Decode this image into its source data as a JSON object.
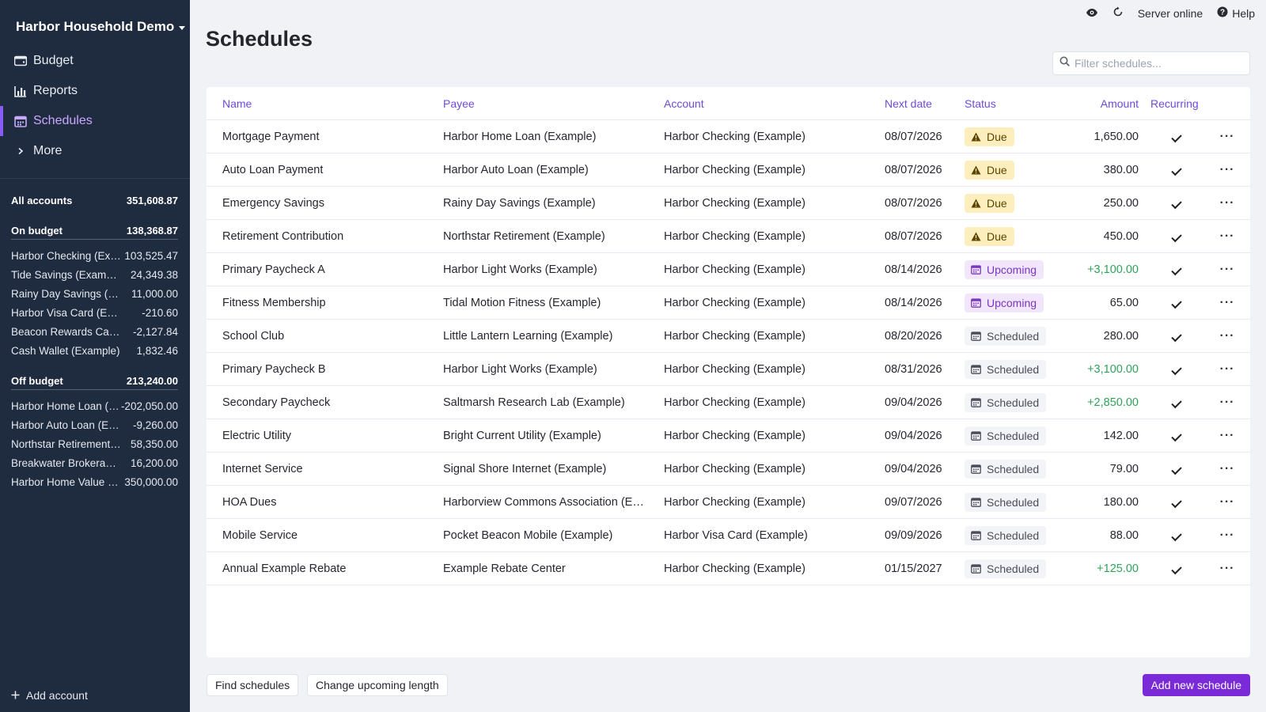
{
  "sidebar": {
    "budget_name": "Harbor Household Demo",
    "nav": [
      {
        "label": "Budget",
        "icon": "wallet-icon"
      },
      {
        "label": "Reports",
        "icon": "bar-chart-icon"
      },
      {
        "label": "Schedules",
        "icon": "calendar-icon",
        "active": true
      },
      {
        "label": "More",
        "icon": "chevron-right-icon"
      }
    ],
    "all_accounts": {
      "label": "All accounts",
      "value": "351,608.87"
    },
    "on_budget": {
      "label": "On budget",
      "value": "138,368.87",
      "accounts": [
        {
          "name": "Harbor Checking (Example)",
          "value": "103,525.47"
        },
        {
          "name": "Tide Savings (Example)",
          "value": "24,349.38"
        },
        {
          "name": "Rainy Day Savings (Example)",
          "value": "11,000.00"
        },
        {
          "name": "Harbor Visa Card (Example)",
          "value": "-210.60"
        },
        {
          "name": "Beacon Rewards Card (Example)",
          "value": "-2,127.84"
        },
        {
          "name": "Cash Wallet (Example)",
          "value": "1,832.46"
        }
      ]
    },
    "off_budget": {
      "label": "Off budget",
      "value": "213,240.00",
      "accounts": [
        {
          "name": "Harbor Home Loan (Example)",
          "value": "-202,050.00"
        },
        {
          "name": "Harbor Auto Loan (Example)",
          "value": "-9,260.00"
        },
        {
          "name": "Northstar Retirement (Example)",
          "value": "58,350.00"
        },
        {
          "name": "Breakwater Brokerage (Example)",
          "value": "16,200.00"
        },
        {
          "name": "Harbor Home Value (Example)",
          "value": "350,000.00"
        }
      ]
    },
    "add_account": "Add account"
  },
  "topbar": {
    "server_status": "Server online",
    "help": "Help"
  },
  "page": {
    "title": "Schedules",
    "filter_placeholder": "Filter schedules..."
  },
  "table": {
    "columns": {
      "name": "Name",
      "payee": "Payee",
      "account": "Account",
      "next_date": "Next date",
      "status": "Status",
      "amount": "Amount",
      "recurring": "Recurring"
    },
    "rows": [
      {
        "name": "Mortgage Payment",
        "payee": "Harbor Home Loan (Example)",
        "account": "Harbor Checking (Example)",
        "date": "08/07/2026",
        "status": "Due",
        "amount": "1,650.00"
      },
      {
        "name": "Auto Loan Payment",
        "payee": "Harbor Auto Loan (Example)",
        "account": "Harbor Checking (Example)",
        "date": "08/07/2026",
        "status": "Due",
        "amount": "380.00"
      },
      {
        "name": "Emergency Savings",
        "payee": "Rainy Day Savings (Example)",
        "account": "Harbor Checking (Example)",
        "date": "08/07/2026",
        "status": "Due",
        "amount": "250.00"
      },
      {
        "name": "Retirement Contribution",
        "payee": "Northstar Retirement (Example)",
        "account": "Harbor Checking (Example)",
        "date": "08/07/2026",
        "status": "Due",
        "amount": "450.00"
      },
      {
        "name": "Primary Paycheck A",
        "payee": "Harbor Light Works (Example)",
        "account": "Harbor Checking (Example)",
        "date": "08/14/2026",
        "status": "Upcoming",
        "amount": "+3,100.00"
      },
      {
        "name": "Fitness Membership",
        "payee": "Tidal Motion Fitness (Example)",
        "account": "Harbor Checking (Example)",
        "date": "08/14/2026",
        "status": "Upcoming",
        "amount": "65.00"
      },
      {
        "name": "School Club",
        "payee": "Little Lantern Learning (Example)",
        "account": "Harbor Checking (Example)",
        "date": "08/20/2026",
        "status": "Scheduled",
        "amount": "280.00"
      },
      {
        "name": "Primary Paycheck B",
        "payee": "Harbor Light Works (Example)",
        "account": "Harbor Checking (Example)",
        "date": "08/31/2026",
        "status": "Scheduled",
        "amount": "+3,100.00"
      },
      {
        "name": "Secondary Paycheck",
        "payee": "Saltmarsh Research Lab (Example)",
        "account": "Harbor Checking (Example)",
        "date": "09/04/2026",
        "status": "Scheduled",
        "amount": "+2,850.00"
      },
      {
        "name": "Electric Utility",
        "payee": "Bright Current Utility (Example)",
        "account": "Harbor Checking (Example)",
        "date": "09/04/2026",
        "status": "Scheduled",
        "amount": "142.00"
      },
      {
        "name": "Internet Service",
        "payee": "Signal Shore Internet (Example)",
        "account": "Harbor Checking (Example)",
        "date": "09/04/2026",
        "status": "Scheduled",
        "amount": "79.00"
      },
      {
        "name": "HOA Dues",
        "payee": "Harborview Commons Association (Example)",
        "account": "Harbor Checking (Example)",
        "date": "09/07/2026",
        "status": "Scheduled",
        "amount": "180.00"
      },
      {
        "name": "Mobile Service",
        "payee": "Pocket Beacon Mobile (Example)",
        "account": "Harbor Visa Card (Example)",
        "date": "09/09/2026",
        "status": "Scheduled",
        "amount": "88.00"
      },
      {
        "name": "Annual Example Rebate",
        "payee": "Example Rebate Center",
        "account": "Harbor Checking (Example)",
        "date": "01/15/2027",
        "status": "Scheduled",
        "amount": "+125.00"
      }
    ]
  },
  "footer": {
    "find_schedules": "Find schedules",
    "change_upcoming_length": "Change upcoming length",
    "add_new_schedule": "Add new schedule"
  },
  "colors": {
    "sidebar_bg": "#1f2b3f",
    "accent": "#7b2ad8",
    "positive": "#2fa35a",
    "due_bg": "#fcefbd",
    "upcoming_bg": "#f1e6fb"
  }
}
